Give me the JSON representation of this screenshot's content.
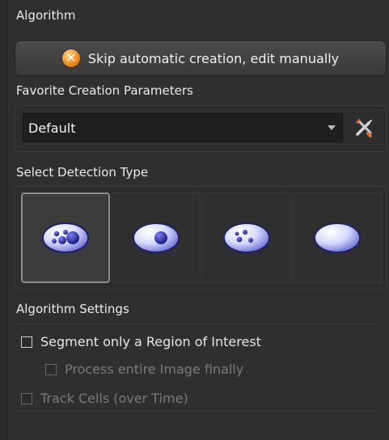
{
  "algorithm": {
    "title": "Algorithm",
    "skip_button_label": "Skip automatic creation, edit manually",
    "skip_icon": "x-circle-orange-icon"
  },
  "favorites": {
    "title": "Favorite Creation Parameters",
    "selected": "Default",
    "tool_icon": "wrench-screwdriver-icon"
  },
  "detection": {
    "title": "Select Detection Type",
    "types": [
      {
        "icon": "cells-multiple-nuclei-icon",
        "selected": true
      },
      {
        "icon": "cell-single-nucleus-icon",
        "selected": false
      },
      {
        "icon": "cell-small-nuclei-icon",
        "selected": false
      },
      {
        "icon": "cell-plain-icon",
        "selected": false
      }
    ]
  },
  "settings": {
    "title": "Algorithm Settings",
    "roi_label": "Segment only a Region of Interest",
    "process_entire_label": "Process entire Image finally",
    "track_cells_label": "Track Cells (over Time)"
  },
  "colors": {
    "background": "#2f2f2f",
    "accent_orange": "#f08a12",
    "cell_blue": "#2a2a8f"
  }
}
